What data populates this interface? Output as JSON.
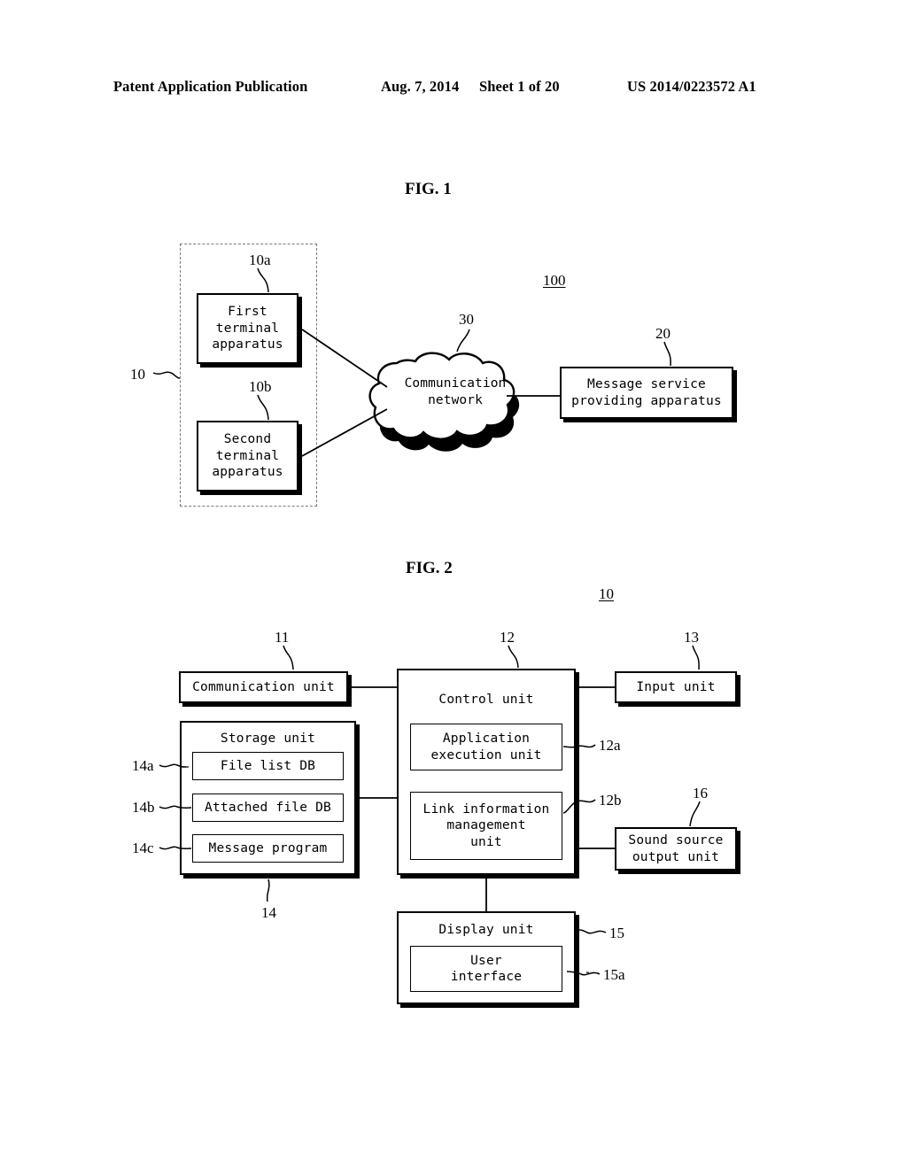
{
  "header": {
    "publication": "Patent Application Publication",
    "date": "Aug. 7, 2014",
    "sheet": "Sheet 1 of 20",
    "patent_number": "US 2014/0223572 A1"
  },
  "figures": [
    {
      "title": "FIG. 1",
      "system_ref": "100",
      "group_ref": "10",
      "nodes": [
        {
          "ref": "10a",
          "label": "First\nterminal\napparatus"
        },
        {
          "ref": "10b",
          "label": "Second\nterminal\napparatus"
        },
        {
          "ref": "30",
          "label": "Communication\nnetwork"
        },
        {
          "ref": "20",
          "label": "Message service\nproviding apparatus"
        }
      ]
    },
    {
      "title": "FIG. 2",
      "device_ref": "10",
      "nodes": [
        {
          "ref": "11",
          "label": "Communication unit"
        },
        {
          "ref": "12",
          "label": "Control unit"
        },
        {
          "ref": "13",
          "label": "Input unit"
        },
        {
          "ref": "12a",
          "label": "Application\nexecution unit"
        },
        {
          "ref": "12b",
          "label": "Link information\nmanagement\nunit"
        },
        {
          "ref": "14",
          "label": "Storage unit"
        },
        {
          "ref": "14a",
          "label": "File list DB"
        },
        {
          "ref": "14b",
          "label": "Attached file DB"
        },
        {
          "ref": "14c",
          "label": "Message program"
        },
        {
          "ref": "16",
          "label": "Sound source\noutput unit"
        },
        {
          "ref": "15",
          "label": "Display unit"
        },
        {
          "ref": "15a",
          "label": "User\ninterface"
        }
      ]
    }
  ]
}
